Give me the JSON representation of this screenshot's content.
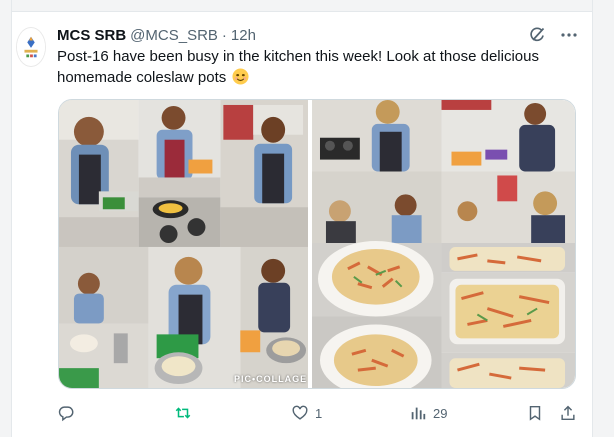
{
  "tweet": {
    "author_name": "MCS SRB",
    "handle": "@MCS_SRB",
    "separator": "·",
    "time": "12h",
    "text": "Post-16 have been busy in the kitchen this week! Look at those delicious homemade coleslaw pots",
    "emoji": "smiling-face-emoji",
    "media_watermark": "PIC•COLLAGE"
  },
  "actions": {
    "reply_count": "",
    "retweet_count": "",
    "like_count": "1",
    "views_count": "29"
  },
  "colors": {
    "text": "#0f1419",
    "secondary": "#536471",
    "retweet_accent": "#00ba7c",
    "border": "#cfd9de"
  },
  "icons": [
    "reply-icon",
    "retweet-icon",
    "heart-icon",
    "views-icon",
    "bookmark-icon",
    "share-icon",
    "grok-icon",
    "more-icon"
  ]
}
